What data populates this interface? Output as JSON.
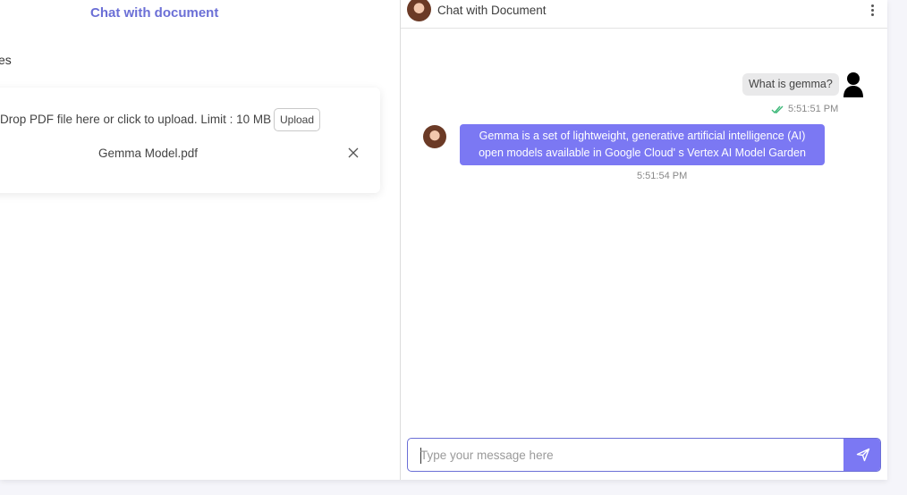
{
  "left_panel": {
    "title": "Chat with document",
    "section_label": "es",
    "upload": {
      "drop_text": "Drop PDF file here or click to upload. Limit : 10 MB",
      "upload_button": "Upload",
      "file_name": "Gemma Model.pdf"
    }
  },
  "chat": {
    "header_title": "Chat with Document",
    "messages": [
      {
        "sender": "user",
        "text": "What is gemma?",
        "time": "5:51:51 PM",
        "status": "read"
      },
      {
        "sender": "bot",
        "text": "Gemma is a set of lightweight, generative artificial intelligence (AI) open models available in Google Cloud' s Vertex AI Model Garden",
        "time": "5:51:54 PM"
      }
    ],
    "composer": {
      "placeholder": "Type your message here",
      "value": ""
    }
  },
  "colors": {
    "accent": "#7b78f3",
    "title_accent": "#6b6fd6",
    "read_tick": "#3cb878"
  },
  "icons": {
    "remove": "close-icon",
    "menu": "kebab-menu-icon",
    "send": "send-icon",
    "user": "user-avatar-icon",
    "read": "double-check-icon"
  }
}
